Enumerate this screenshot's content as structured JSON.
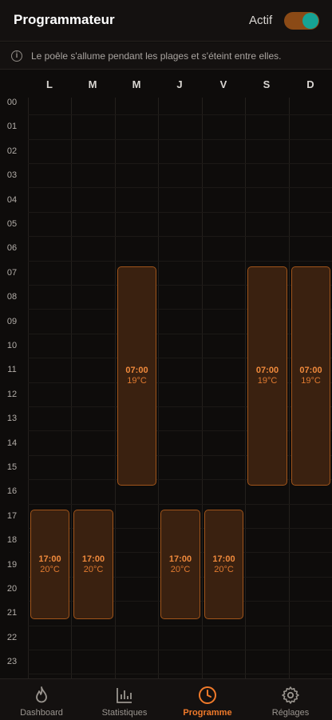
{
  "header": {
    "title": "Programmateur",
    "active_label": "Actif",
    "active": true
  },
  "info": {
    "text": "Le poêle s'allume pendant les plages et s'éteint entre elles."
  },
  "schedule": {
    "days": [
      "L",
      "M",
      "M",
      "J",
      "V",
      "S",
      "D"
    ],
    "hours": [
      "00",
      "01",
      "02",
      "03",
      "04",
      "05",
      "06",
      "07",
      "08",
      "09",
      "10",
      "11",
      "12",
      "13",
      "14",
      "15",
      "16",
      "17",
      "18",
      "19",
      "20",
      "21",
      "22",
      "23"
    ],
    "slots": [
      {
        "day": 0,
        "start": "17:00",
        "temp": "20°C"
      },
      {
        "day": 1,
        "start": "17:00",
        "temp": "20°C"
      },
      {
        "day": 2,
        "start": "07:00",
        "temp": "19°C"
      },
      {
        "day": 3,
        "start": "17:00",
        "temp": "20°C"
      },
      {
        "day": 4,
        "start": "17:00",
        "temp": "20°C"
      },
      {
        "day": 5,
        "start": "07:00",
        "temp": "19°C"
      },
      {
        "day": 6,
        "start": "07:00",
        "temp": "19°C"
      }
    ]
  },
  "tabs": [
    {
      "label": "Dashboard",
      "icon": "flame-icon"
    },
    {
      "label": "Statistiques",
      "icon": "bar-chart-icon"
    },
    {
      "label": "Programme",
      "icon": "clock-icon",
      "active": true
    },
    {
      "label": "Réglages",
      "icon": "gear-icon"
    }
  ],
  "colors": {
    "accent": "#f07a2a",
    "toggle_on": "#16a394",
    "slot_fill": "#3a2110",
    "slot_border": "#a0541a"
  }
}
